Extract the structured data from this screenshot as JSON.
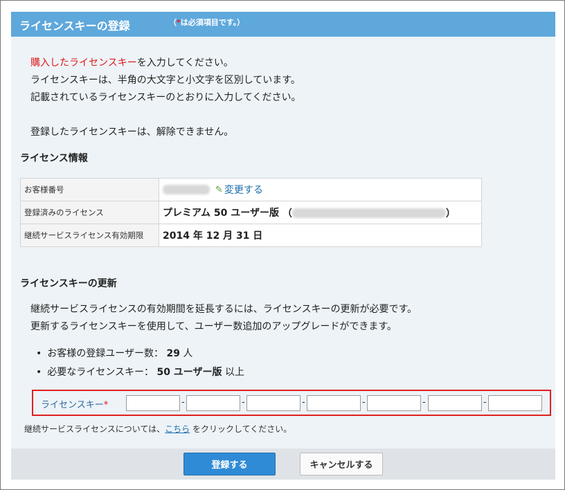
{
  "header": {
    "title": "ライセンスキーの登録",
    "required_note_prefix": "（",
    "required_star": "*",
    "required_note": "は必須項目です。）"
  },
  "intro": {
    "line1_red": "購入したライセンスキー",
    "line1_rest": "を入力してください。",
    "line2": "ライセンスキーは、半角の大文字と小文字を区別しています。",
    "line3": "記載されているライセンスキーのとおりに入力してください。",
    "line4": "登録したライセンスキーは、解除できません。"
  },
  "license_info": {
    "heading": "ライセンス情報",
    "rows": [
      {
        "label": "お客様番号",
        "link": "変更する"
      },
      {
        "label": "登録済みのライセンス",
        "value": "プレミアム  50 ユーザー版",
        "open": "（",
        "close": "）"
      },
      {
        "label": "継続サービスライセンス有効期限",
        "value": "2014 年 12 月 31 日"
      }
    ]
  },
  "update": {
    "heading": "ライセンスキーの更新",
    "desc1": "継続サービスライセンスの有効期間を延長するには、ライセンスキーの更新が必要です。",
    "desc2": "更新するライセンスキーを使用して、ユーザー数追加のアップグレードができます。",
    "bullet1_label": "お客様の登録ユーザー数：",
    "bullet1_value": "29",
    "bullet1_unit": "人",
    "bullet2_label": "必要なライセンスキー：",
    "bullet2_value": "50 ユーザー版",
    "bullet2_unit": "以上"
  },
  "key_input": {
    "label": "ライセンスキー",
    "star": "*",
    "segments": [
      "",
      "",
      "",
      "",
      "",
      "",
      ""
    ],
    "separator": "-"
  },
  "footnote": {
    "before": "継続サービスライセンスについては、",
    "link": "こちら",
    "after": "をクリックしてください。"
  },
  "buttons": {
    "register": "登録する",
    "cancel": "キャンセルする"
  },
  "colors": {
    "title_bar": "#5ea8dc",
    "required_red": "#e01a1a",
    "link_blue": "#1a6dab",
    "primary_button": "#2f8bd6",
    "highlight_border": "#e02020"
  }
}
